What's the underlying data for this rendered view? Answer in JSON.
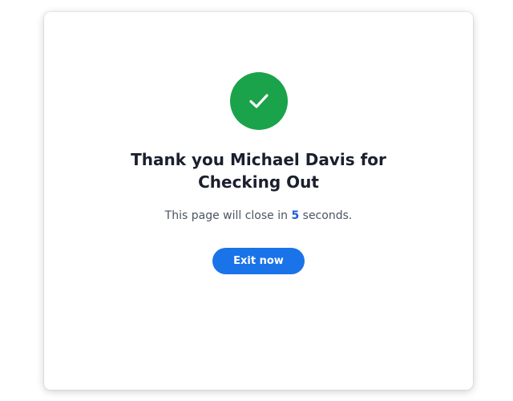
{
  "dialog": {
    "title_line1": "Thank you Michael Davis for",
    "title_line2": "Checking Out",
    "message_prefix": "This page will close in ",
    "countdown_seconds": "5",
    "message_suffix": " seconds.",
    "exit_label": "Exit now"
  },
  "icons": {
    "success": "check-circle"
  },
  "colors": {
    "success_green": "#1aa34a",
    "accent_blue": "#1a73e8",
    "countdown_blue": "#1a5fd6",
    "title_text": "#1b1f2e",
    "body_text": "#4b5563"
  }
}
